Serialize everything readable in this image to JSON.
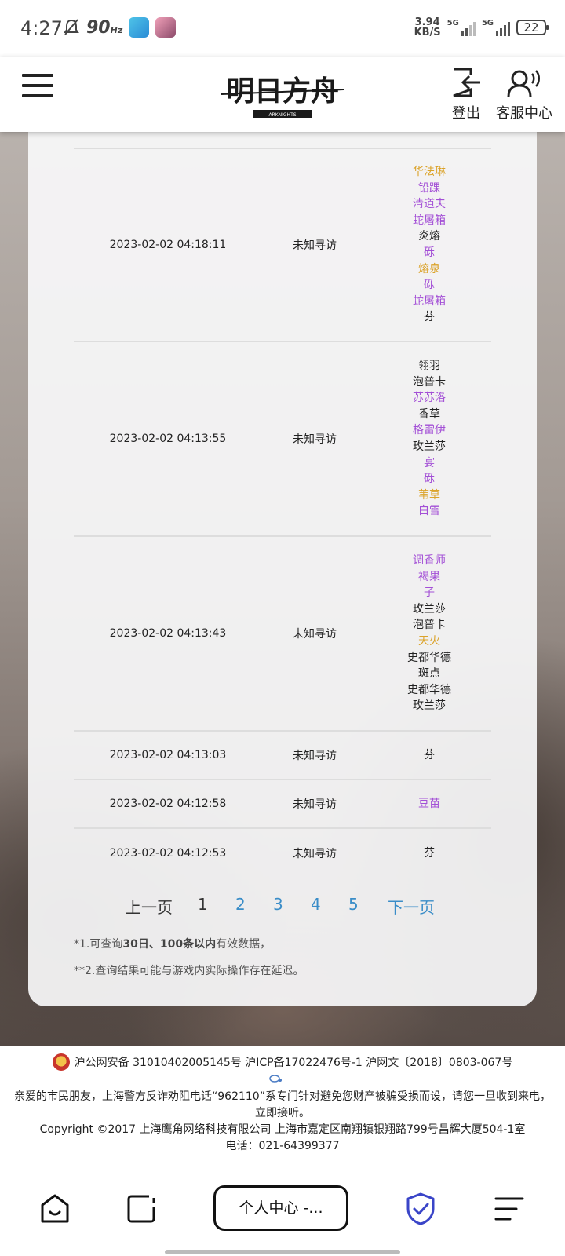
{
  "status_bar": {
    "time": "4:27",
    "refresh_rate": "90",
    "refresh_unit": "Hz",
    "net_speed_value": "3.94",
    "net_speed_unit": "KB/S",
    "sim1_label": "5G",
    "sim2_label": "5G",
    "battery": "22"
  },
  "header": {
    "logo_text": "明日方舟",
    "logo_sub": "ARKNIGHTS",
    "logout_label": "登出",
    "service_label": "客服中心"
  },
  "records": [
    {
      "time": "2023-02-02 04:18:11",
      "type": "未知寻访",
      "operators": [
        {
          "name": "华法琳",
          "rarity": "5"
        },
        {
          "name": "铅踝",
          "rarity": "4"
        },
        {
          "name": "清道夫",
          "rarity": "4"
        },
        {
          "name": "蛇屠箱",
          "rarity": "4"
        },
        {
          "name": "炎熔",
          "rarity": "3"
        },
        {
          "name": "砾",
          "rarity": "4"
        },
        {
          "name": "熔泉",
          "rarity": "5"
        },
        {
          "name": "砾",
          "rarity": "4"
        },
        {
          "name": "蛇屠箱",
          "rarity": "4"
        },
        {
          "name": "芬",
          "rarity": "3"
        }
      ]
    },
    {
      "time": "2023-02-02 04:13:55",
      "type": "未知寻访",
      "operators": [
        {
          "name": "翎羽",
          "rarity": "3"
        },
        {
          "name": "泡普卡",
          "rarity": "3"
        },
        {
          "name": "苏苏洛",
          "rarity": "4"
        },
        {
          "name": "香草",
          "rarity": "3"
        },
        {
          "name": "格雷伊",
          "rarity": "4"
        },
        {
          "name": "玫兰莎",
          "rarity": "3"
        },
        {
          "name": "宴",
          "rarity": "4"
        },
        {
          "name": "砾",
          "rarity": "4"
        },
        {
          "name": "苇草",
          "rarity": "5"
        },
        {
          "name": "白雪",
          "rarity": "4"
        }
      ]
    },
    {
      "time": "2023-02-02 04:13:43",
      "type": "未知寻访",
      "operators": [
        {
          "name": "调香师",
          "rarity": "4"
        },
        {
          "name": "褐果",
          "rarity": "4"
        },
        {
          "name": "子",
          "rarity": "4"
        },
        {
          "name": "玫兰莎",
          "rarity": "3"
        },
        {
          "name": "泡普卡",
          "rarity": "3"
        },
        {
          "name": "天火",
          "rarity": "5"
        },
        {
          "name": "史都华德",
          "rarity": "3"
        },
        {
          "name": "斑点",
          "rarity": "3"
        },
        {
          "name": "史都华德",
          "rarity": "3"
        },
        {
          "name": "玫兰莎",
          "rarity": "3"
        }
      ]
    },
    {
      "time": "2023-02-02 04:13:03",
      "type": "未知寻访",
      "operators": [
        {
          "name": "芬",
          "rarity": "3"
        }
      ]
    },
    {
      "time": "2023-02-02 04:12:58",
      "type": "未知寻访",
      "operators": [
        {
          "name": "豆苗",
          "rarity": "4"
        }
      ]
    },
    {
      "time": "2023-02-02 04:12:53",
      "type": "未知寻访",
      "operators": [
        {
          "name": "芬",
          "rarity": "3"
        }
      ]
    }
  ],
  "pagination": {
    "prev": "上一页",
    "pages": [
      "1",
      "2",
      "3",
      "4",
      "5"
    ],
    "next": "下一页",
    "current": "1"
  },
  "notes": {
    "note1_pre": "*1.可查询",
    "note1_bold": "30日、100条以内",
    "note1_post": "有效数据，",
    "note2": "**2.查询结果可能与游戏内实际操作存在延迟。"
  },
  "footer": {
    "beian": "沪公网安备 31010402005145号  沪ICP备17022476号-1  沪网文〔2018〕0803-067号",
    "warning_line1": "亲爱的市民朋友，上海警方反诈劝阻电话“962110”系专门针对避免您财产被骗受损而设，请您一旦收到来电，",
    "warning_line2": "立即接听。",
    "copyright": "Copyright ©2017 上海鹰角网络科技有限公司  上海市嘉定区南翔镇银翔路799号昌辉大厦504-1室",
    "phone": "电话：021-64399377"
  },
  "browser_bar": {
    "center_label": "个人中心 -..."
  },
  "colors": {
    "rarity_4": "#a34fd6",
    "rarity_5": "#dba32a",
    "rarity_3": "#222222",
    "link": "#3a8dc8"
  }
}
